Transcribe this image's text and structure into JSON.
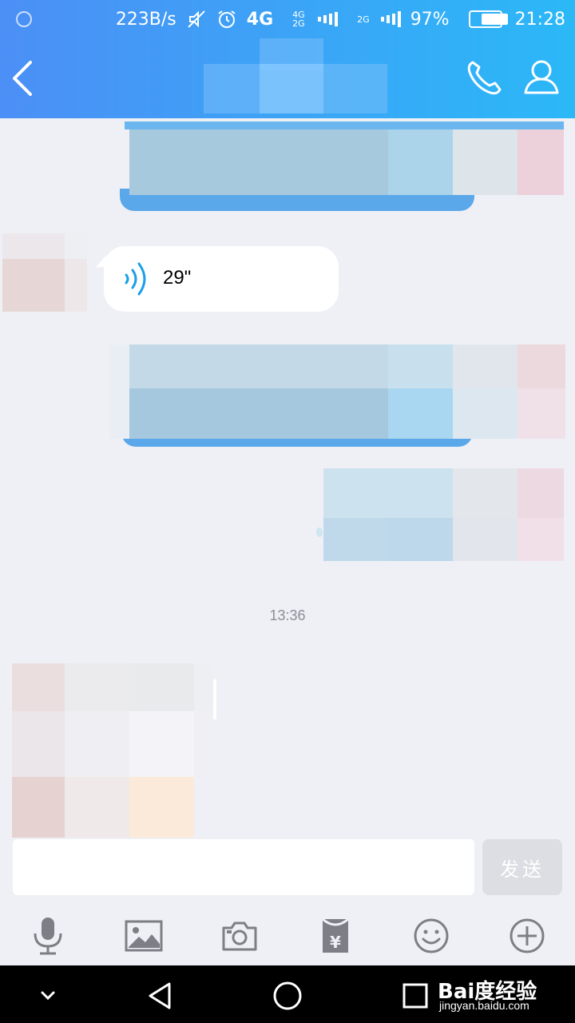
{
  "status_bar": {
    "net_speed": "223B/s",
    "network_4g": "4G",
    "network_4g_2g": "4G 2G",
    "network_2g": "2G",
    "battery_percent": "97%",
    "battery_level": 0.97,
    "time": "21:28",
    "icons": [
      "mute-icon",
      "alarm-icon",
      "signal-icon",
      "battery-icon"
    ]
  },
  "nav": {
    "back_icon": "back-arrow-icon",
    "contact_name": "",
    "call_icon": "phone-icon",
    "profile_icon": "profile-icon"
  },
  "chat": {
    "voice_message": {
      "duration": "29\""
    },
    "timestamp": "13:36"
  },
  "input": {
    "message_value": "",
    "send_label": "发送"
  },
  "toolbar": {
    "items": [
      "microphone-icon",
      "image-icon",
      "camera-icon",
      "red-packet-icon",
      "emoji-icon",
      "plus-icon"
    ],
    "red_packet_symbol": "¥"
  },
  "system_nav": {
    "items": [
      "collapse-icon",
      "back-triangle-icon",
      "home-circle-icon",
      "recents-square-icon"
    ]
  },
  "watermark": {
    "brand": "Bai度经验",
    "url": "jingyan.baidu.com"
  },
  "colors": {
    "header_start": "#4c8ff6",
    "header_end": "#2bb8f7",
    "chat_bg": "#eff0f5",
    "voice_wave": "#1aa0e6"
  }
}
